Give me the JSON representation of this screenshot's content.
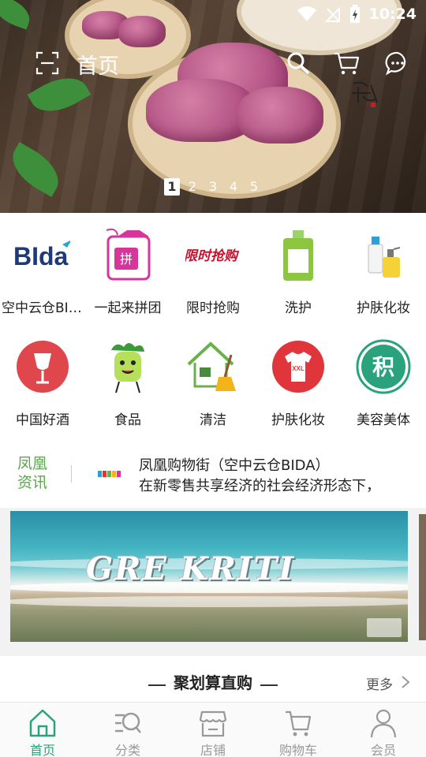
{
  "status_bar": {
    "time": "10:24"
  },
  "top_bar": {
    "title": "首页"
  },
  "hero": {
    "pages": [
      "1",
      "2",
      "3",
      "4",
      "5"
    ],
    "active_page": 1
  },
  "categories": [
    {
      "label": "空中云仓BIDA",
      "icon": "bida-logo-icon"
    },
    {
      "label": "一起来拼团",
      "icon": "group-buy-tag-icon"
    },
    {
      "label": "限时抢购",
      "icon": "flash-sale-icon"
    },
    {
      "label": "洗护",
      "icon": "bottle-icon"
    },
    {
      "label": "护肤化妆",
      "icon": "skincare-bottles-icon"
    },
    {
      "label": "中国好酒",
      "icon": "wine-glass-icon"
    },
    {
      "label": "食品",
      "icon": "celery-character-icon"
    },
    {
      "label": "清洁",
      "icon": "house-broom-icon"
    },
    {
      "label": "护肤化妆",
      "icon": "tshirt-icon"
    },
    {
      "label": "美容美体",
      "icon": "points-icon"
    }
  ],
  "category_logo_text": {
    "bida": "BIda",
    "flash_sale": "限时抢购",
    "points": "积",
    "tshirt_size": "XXL",
    "group_buy": "拼"
  },
  "news": {
    "tag": "凤凰资讯",
    "headline": "凤凰购物街（空中云仓BIDA）",
    "summary": "在新零售共享经济的社会经济形态下，"
  },
  "promo": {
    "title": "GRE KRITI"
  },
  "section": {
    "title": "聚划算直购",
    "more": "更多"
  },
  "bottom_nav": [
    {
      "label": "首页",
      "active": true
    },
    {
      "label": "分类",
      "active": false
    },
    {
      "label": "店铺",
      "active": false
    },
    {
      "label": "购物车",
      "active": false
    },
    {
      "label": "会员",
      "active": false
    }
  ],
  "colors": {
    "accent": "#2aa37c",
    "news_tag": "#5aa84b",
    "group_buy": "#d6359b",
    "flash_sale": "#c8102e"
  }
}
